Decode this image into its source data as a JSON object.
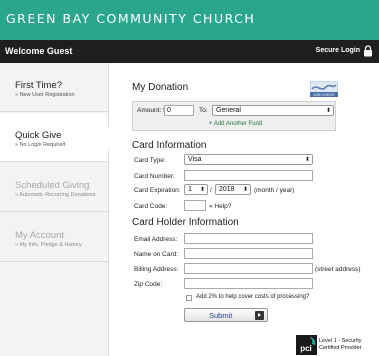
{
  "header": {
    "title": "GREEN BAY COMMUNITY CHURCH"
  },
  "bar": {
    "welcome": "Welcome Guest",
    "secure_login": "Secure Login"
  },
  "sidebar": {
    "items": [
      {
        "main": "First Time?",
        "sub": "» New User Registration",
        "state": "normal"
      },
      {
        "main": "Quick Give",
        "sub": "» No Login Required",
        "state": "active"
      },
      {
        "main": "Scheduled Giving",
        "sub": "» Automatic Recurring Donations",
        "state": "disabled"
      },
      {
        "main": "My Account",
        "sub": "» My Info, Pledge & History",
        "state": "disabled"
      }
    ]
  },
  "donation": {
    "heading": "My Donation",
    "amount_label": "Amount: $",
    "amount_value": "0",
    "to_label": "To:",
    "fund_selected": "General",
    "add_fund": "+ Add Another Fund",
    "icon": "use-check-icon",
    "icon_text": "USE CHECK"
  },
  "card": {
    "heading": "Card Information",
    "type_label": "Card Type:",
    "type_value": "Visa",
    "number_label": "Card Number:",
    "number_value": "",
    "expiration_label": "Card Expiration:",
    "month_value": "1",
    "slash": "/",
    "year_value": "2018",
    "month_year_hint": "(month / year)",
    "code_label": "Card Code:",
    "code_value": "",
    "help_link": "« Help?"
  },
  "holder": {
    "heading": "Card Holder Information",
    "email_label": "Email Address:",
    "email_value": "",
    "name_label": "Name on Card:",
    "name_value": "",
    "billing_label": "Billing Address:",
    "billing_value": "",
    "street_hint": "(street address)",
    "zip_label": "Zip Code:",
    "zip_value": "",
    "cover_costs": "Add 2% to help cover costs of processing?"
  },
  "submit": {
    "label": "Submit"
  },
  "pci": {
    "logo": "pci",
    "line1": "Level 1 - Security",
    "line2": "Certified Provider"
  },
  "colors": {
    "header": "#2aa58e",
    "bar": "#1f1f1f",
    "link": "#1d7a3d"
  }
}
